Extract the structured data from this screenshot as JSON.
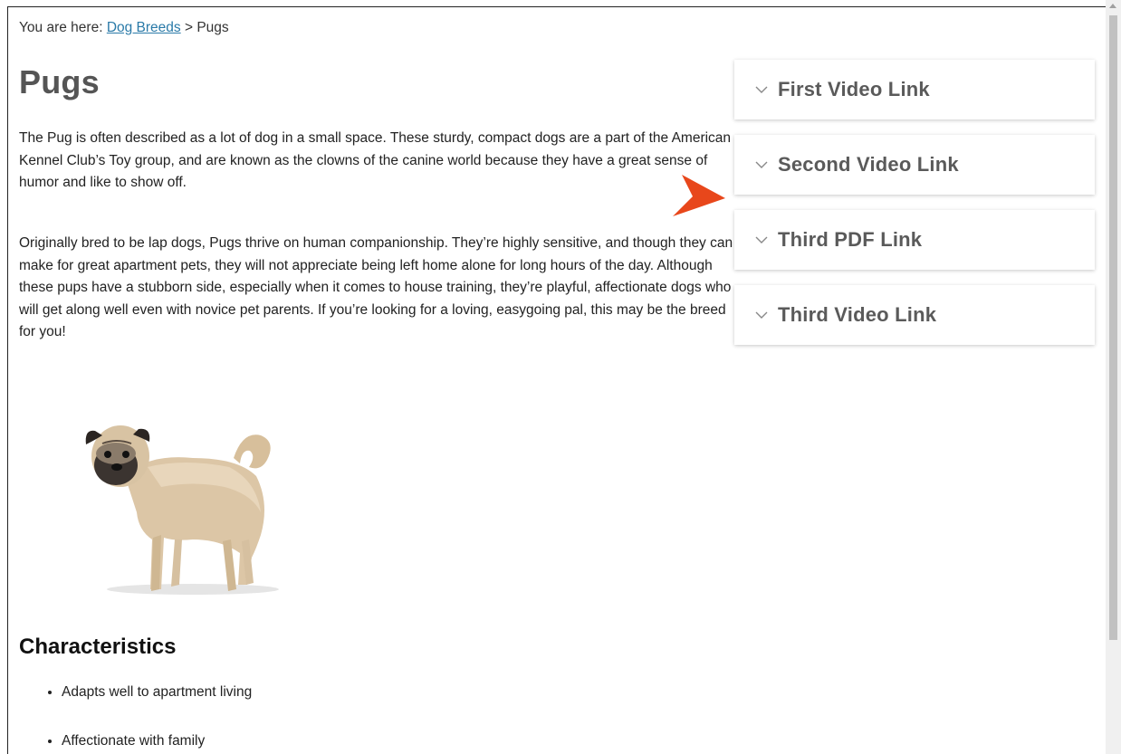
{
  "breadcrumb": {
    "prefix": "You are here: ",
    "link": "Dog Breeds",
    "separator": " > ",
    "current": "Pugs"
  },
  "page": {
    "title": "Pugs",
    "paragraph1": "The Pug is often described as a lot of dog in a small space. These sturdy, compact dogs are a part of the American Kennel Club’s Toy group, and are known as the clowns of the canine world because they have a great sense of humor and like to show off.",
    "paragraph2": "Originally bred to be lap dogs, Pugs thrive on human companionship. They’re highly sensitive, and though they can make for great apartment pets, they will not appreciate being left home alone for long hours of the day. Although these pups have a stubborn side, especially when it comes to house training, they’re playful, affectionate dogs who will get along well even with novice pet parents. If you’re looking for a loving, easygoing pal, this may be the breed for you!",
    "characteristics_title": "Characteristics",
    "characteristics": [
      "Adapts well to apartment living",
      "Affectionate with family"
    ]
  },
  "accordion": [
    {
      "label": "First Video Link",
      "icon": "chevron-down-icon"
    },
    {
      "label": "Second Video Link",
      "icon": "chevron-down-icon"
    },
    {
      "label": "Third PDF Link",
      "icon": "chevron-down-icon"
    },
    {
      "label": "Third Video Link",
      "icon": "chevron-down-icon"
    }
  ],
  "colors": {
    "link": "#2a7aa8",
    "pointer": "#e8471b",
    "heading": "#555555"
  }
}
